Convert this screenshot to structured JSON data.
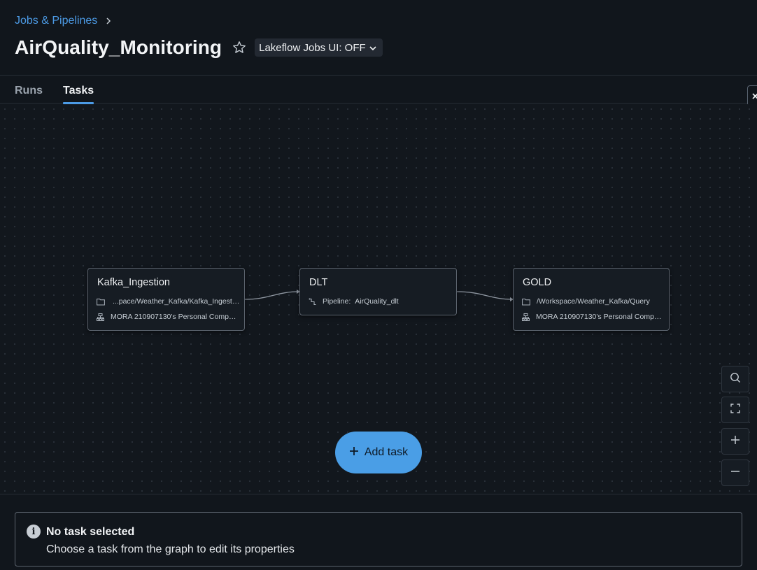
{
  "breadcrumb": {
    "parent": "Jobs & Pipelines"
  },
  "header": {
    "title": "AirQuality_Monitoring",
    "lakeflow_toggle": "Lakeflow Jobs UI: OFF"
  },
  "tabs": [
    {
      "label": "Runs",
      "active": false
    },
    {
      "label": "Tasks",
      "active": true
    }
  ],
  "graph": {
    "nodes": [
      {
        "name": "Kafka_Ingestion",
        "line1_icon": "folder-icon",
        "line1": "...pace/Weather_Kafka/Kafka_Ingestion",
        "line2_icon": "cluster-icon",
        "line2": "MORA 210907130's Personal Comput..."
      },
      {
        "name": "DLT",
        "line1_icon": "pipeline-icon",
        "line1_label": "Pipeline:",
        "line1": "AirQuality_dlt"
      },
      {
        "name": "GOLD",
        "line1_icon": "folder-icon",
        "line1": "/Workspace/Weather_Kafka/Query",
        "line2_icon": "cluster-icon",
        "line2": "MORA 210907130's Personal Comput..."
      }
    ],
    "edges": [
      [
        "Kafka_Ingestion",
        "DLT"
      ],
      [
        "DLT",
        "GOLD"
      ]
    ],
    "add_task_label": "Add task"
  },
  "info_panel": {
    "title": "No task selected",
    "description": "Choose a task from the graph to edit its properties"
  },
  "colors": {
    "background": "#11161c",
    "accent": "#4c9be6",
    "add_button": "#4a9ee6",
    "node_border": "#5b636d"
  }
}
